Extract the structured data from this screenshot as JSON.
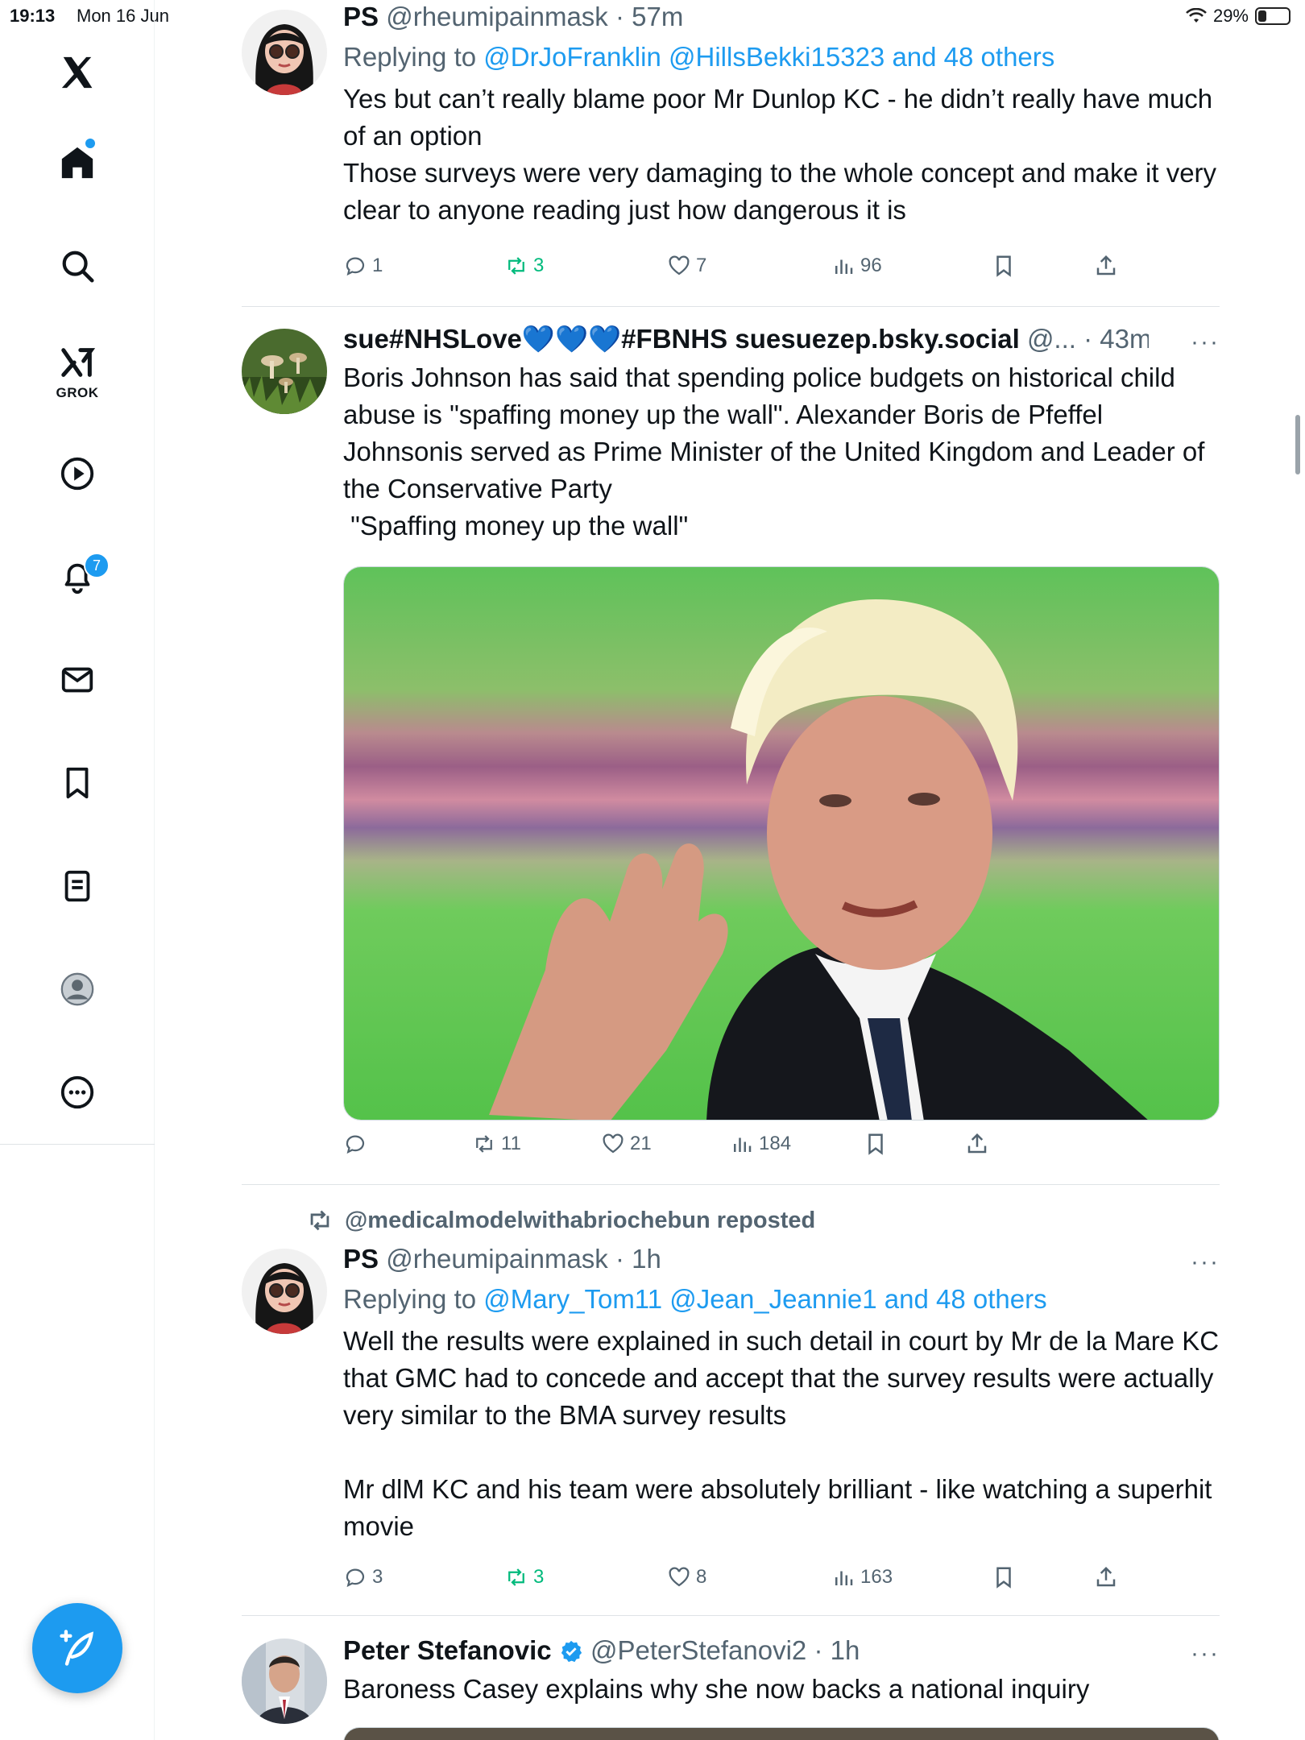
{
  "status": {
    "time": "19:13",
    "date": "Mon 16 Jun",
    "battery": "29%",
    "battery_level": 0.29
  },
  "sidebar": {
    "grok_label": "GROK",
    "notifications_count": "7"
  },
  "posts": [
    {
      "name": "PS",
      "handle": "@rheumipainmask",
      "time": "57m",
      "replying_prefix": "Replying to",
      "replying_to": "@DrJoFranklin @HillsBekki15323 and 48 others",
      "text": "Yes but can’t really blame poor Mr Dunlop KC - he didn’t really have much of an option\nThose surveys were very damaging to the whole concept and make it very clear to anyone reading just how dangerous it is",
      "replies": "1",
      "reposts": "3",
      "likes": "7",
      "views": "96"
    },
    {
      "name": "sue#NHSLove💙💙💙#FBNHS suesuezep.bsky.social",
      "handle": "@...",
      "time": "43m",
      "more": "···",
      "text": "Boris Johnson has said that spending police budgets on historical child abuse is \"spaffing money up the wall\". Alexander Boris de Pfeffel Johnsonis served as Prime Minister of the United Kingdom and Leader of the Conservative Party\n \"Spaffing money up the wall\"",
      "replies": "",
      "reposts": "11",
      "likes": "21",
      "views": "184"
    },
    {
      "repost_label": "@medicalmodelwithabriochebun reposted",
      "name": "PS",
      "handle": "@rheumipainmask",
      "time": "1h",
      "more": "···",
      "replying_prefix": "Replying to",
      "replying_to": "@Mary_Tom11 @Jean_Jeannie1 and 48 others",
      "text": "Well the results were explained in such detail in court by Mr de la Mare KC that GMC had to concede and accept that the survey results were actually very similar to the BMA survey results\n\nMr dlM KC and his team were absolutely brilliant - like watching a superhit movie",
      "replies": "3",
      "reposts": "3",
      "likes": "8",
      "views": "163"
    },
    {
      "name": "Peter Stefanovic",
      "handle": "@PeterStefanovi2",
      "time": "1h",
      "more": "···",
      "text": "Baroness Casey explains why she now backs a national inquiry"
    }
  ],
  "colors": {
    "accent": "#1d9bf0",
    "retweet": "#00ba7c",
    "muted": "#536471"
  }
}
